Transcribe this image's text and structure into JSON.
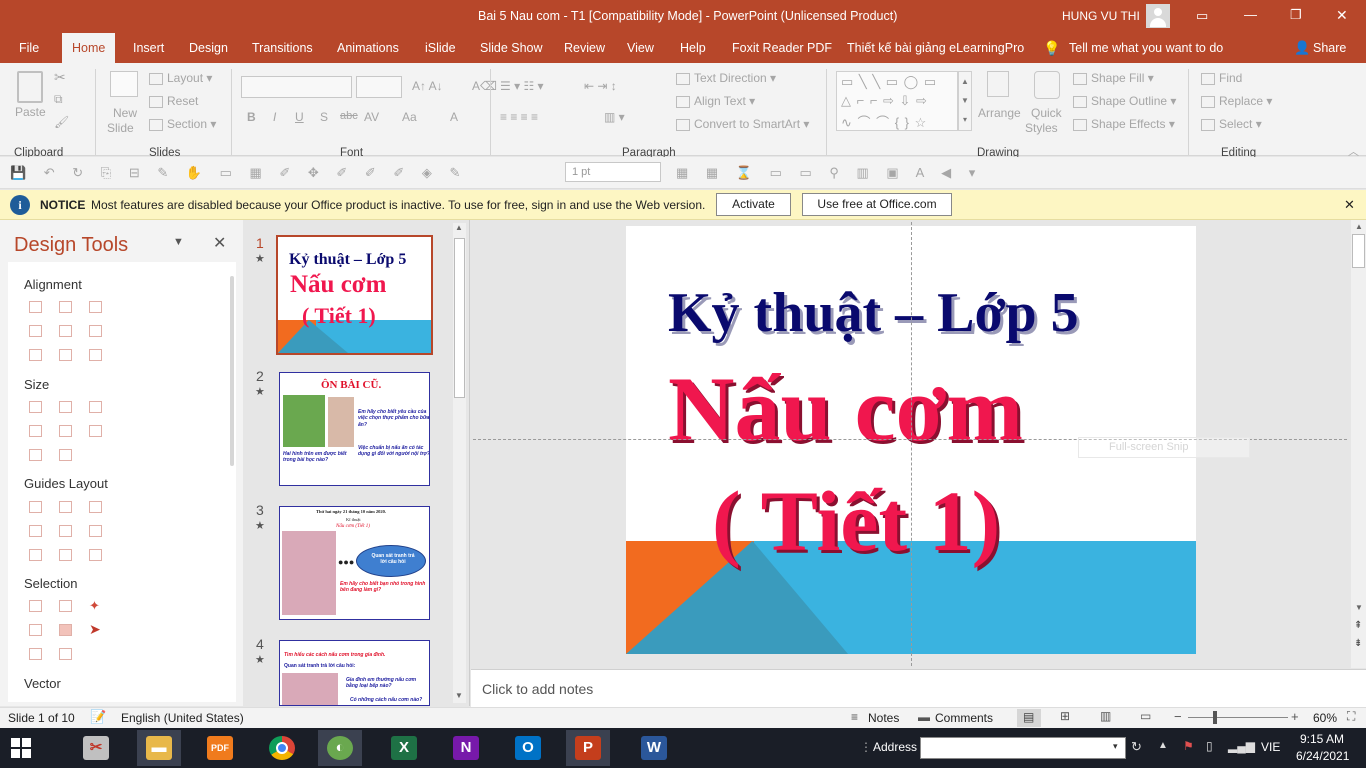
{
  "window": {
    "title": "Bai 5 Nau com - T1 [Compatibility Mode]  -  PowerPoint (Unlicensed Product)",
    "user": "HUNG VU THI",
    "minimize": "—",
    "restore": "❐",
    "close": "✕"
  },
  "ribbon_tabs": [
    "File",
    "Home",
    "Insert",
    "Design",
    "Transitions",
    "Animations",
    "iSlide",
    "Slide Show",
    "Review",
    "View",
    "Help",
    "Foxit Reader PDF",
    "Thiết kế bài giảng eLearningPro"
  ],
  "tell_me": "Tell me what you want to do",
  "share": "Share",
  "ribbon": {
    "clipboard": {
      "label": "Clipboard",
      "paste": "Paste"
    },
    "slides": {
      "label": "Slides",
      "new_slide_1": "New",
      "new_slide_2": "Slide",
      "layout": "Layout",
      "reset": "Reset",
      "section": "Section"
    },
    "font": {
      "label": "Font",
      "bold": "B",
      "italic": "I",
      "underline": "U",
      "shadow": "S",
      "strike": "abc",
      "spacing": "AV",
      "case": "Aa",
      "color": "A"
    },
    "paragraph": {
      "label": "Paragraph",
      "text_direction": "Text Direction",
      "align_text": "Align Text",
      "convert_smartart": "Convert to SmartArt"
    },
    "drawing": {
      "label": "Drawing",
      "arrange": "Arrange",
      "quick_styles_1": "Quick",
      "quick_styles_2": "Styles",
      "shape_fill": "Shape Fill",
      "shape_outline": "Shape Outline",
      "shape_effects": "Shape Effects"
    },
    "editing": {
      "label": "Editing",
      "find": "Find",
      "replace": "Replace",
      "select": "Select"
    }
  },
  "qat": {
    "line_weight": "1 pt"
  },
  "notice": {
    "title": "NOTICE",
    "message": "Most features are disabled because your Office product is inactive. To use for free, sign in and use the Web version.",
    "activate": "Activate",
    "use_free": "Use free at Office.com"
  },
  "design_tools": {
    "title": "Design Tools",
    "sections": [
      "Alignment",
      "Size",
      "Guides Layout",
      "Selection",
      "Vector"
    ]
  },
  "thumbnails": [
    {
      "num": "1",
      "star": "★",
      "line1": "Kỷ thuật – Lớp 5",
      "line2": "Nấu cơm",
      "line3": "( Tiết 1)"
    },
    {
      "num": "2",
      "star": "★",
      "title": "ÔN BÀI CŨ.",
      "b1": "Em hãy cho biết yêu cầu của việc chọn thực phẩm cho bữa ăn?",
      "b2": "Việc chuẩn bị nấu ăn có tác dụng gì đối với người nội trợ?",
      "b3": "Hai hình trên em được biết trong bài học nào?"
    },
    {
      "num": "3",
      "star": "★",
      "date": "Thứ hai ngày 21 tháng 10 năm 2020.",
      "subject": "Kĩ thuật",
      "lesson": "Nấu cơm (Tiết 1)",
      "bubble": "Quan sát tranh trả lời câu hỏi",
      "question": "Em hãy cho biết bạn nhỏ trong hình bên đang làm gì?"
    },
    {
      "num": "4",
      "star": "★",
      "l1": "Tìm hiểu các cách nấu cơm trong gia đình.",
      "l2": "Quan sát tranh trả lời câu hỏi:",
      "q1": "Gia đình em thường nấu cơm bằng loại bếp nào?",
      "q2": "Có những cách nấu cơm nào?"
    }
  ],
  "slide": {
    "line1": "Kỷ thuật – Lớp 5",
    "line2": "Nấu cơm",
    "line3": "( Tiết 1)",
    "overlay": "Full-screen Snip"
  },
  "notes_placeholder": "Click to add notes",
  "status": {
    "slide": "Slide 1 of 10",
    "language": "English (United States)",
    "notes": "Notes",
    "comments": "Comments",
    "zoom": "60%"
  },
  "taskbar": {
    "address_label": "Address",
    "lang": "VIE",
    "time": "9:15 AM",
    "date": "6/24/2021"
  },
  "colors": {
    "accent": "#b7472a",
    "slide_navy": "#0a0a6e",
    "slide_red": "#f0174e",
    "slide_blue": "#3ab3e0",
    "slide_orange": "#f26b1f",
    "slide_teal": "#3a9bbd"
  }
}
